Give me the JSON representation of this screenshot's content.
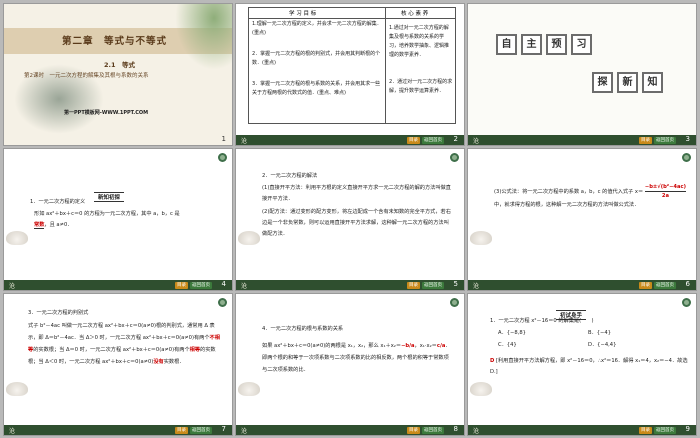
{
  "s1": {
    "chapter": "第二章　等式与不等式",
    "section": "2.1　等式",
    "subtitle": "第2课时　一元二次方程的解集及其根与系数的关系",
    "site": "第一PPT模板网-WWW.1PPT.COM",
    "num": "1"
  },
  "s2": {
    "col1": "学 习 目 标",
    "col2": "核 心 素 养",
    "goals": [
      "1.理解一元二次方程的定义，并会求一元二次方程的解集．(重点)",
      "2．掌握一元二次方程的根的判别式，并会用其判断根的个数．(重点)",
      "3．掌握一元二次方程的根与系数的关系，并会用其求一些关于方程两根的代数式的值．(重点、难点)"
    ],
    "cores": [
      "1.通过对一元二次方程的解集及根与系数的关系的学习，培养数学抽象、逻辑推理的数学素养．",
      "2．通过对一元二次方程的求解，提升数学运算素养．"
    ],
    "num": "2"
  },
  "s3": {
    "a": [
      "自",
      "主",
      "预",
      "习"
    ],
    "b": [
      "探",
      "新",
      "知"
    ],
    "num": "3"
  },
  "s4": {
    "head": "新知初探",
    "t1": "1．一元二次方程的定义",
    "t2": "形如 ax²＋bx＋c＝0 的方程为一元二次方程，其中 a，b，c 是",
    "fill": "常数",
    "t3": "，且 a≠0．",
    "num": "4"
  },
  "s5": {
    "t1": "2．一元二次方程的解法",
    "t2": "(1)直接开平方法：利用平方根的定义直接开平方求一元二次方程的解的方法叫做直接开平方法．",
    "t3": "(2)配方法：通过变形的配方变形，将左边配成一个含有未知数的完全平方式，若右边是一个非负常数，则可以运用直接开平方法求解，这种解一元二次方程的方法叫做配方法．",
    "num": "5"
  },
  "s6": {
    "t1": "(3)公式法：将一元二次方程中的系数 a，b，c 的值代入式子 x＝",
    "f": "−b±√(b²−4ac)",
    "d": "2a",
    "t2": "中，就求得方程的根，这种解一元二次方程的方法叫做公式法．",
    "num": "6"
  },
  "s7": {
    "t1": "3．一元二次方程的判别式",
    "t2": "式子 b²－4ac 叫做一元二次方程 ax²＋bx＋c＝0(a≠0)根的判别式，通常用 Δ 表示，即 Δ＝b²－4ac．当 Δ＞0 时，一元二次方程 ax²",
    "t3": "＋bx＋c＝0(a≠0)有两个",
    "f1": "不相等",
    "t4": "的实数根；当 Δ＝0 时，一元二次方程 ax²＋bx＋c＝0(a≠0)有两个",
    "f2": "相等",
    "t5": "的实数根；当 Δ＜0 时，一元二次方程 ax²＋bx＋c＝0(a≠0)",
    "f3": "没有",
    "t6": "实数根．",
    "num": "7"
  },
  "s8": {
    "t1": "4．一元二次方程的根与系数的关系",
    "t2": "如果 ax²＋bx＋c＝0(a≠0)的两根是 x₁，x₂，那么 x₁＋x₂＝",
    "f1": "−b/a",
    "t3": "，x₁·x₂＝",
    "f2": "c/a",
    "t4": "．即两个根的和等于一次项系数与二次项系数的比的相反数，两个根的积等于常数项与二次项系数的比．",
    "num": "8"
  },
  "s9": {
    "head": "初试身手",
    "q": "1．一元二次方程 x²－16＝0 的解集是(　　)",
    "opts": [
      "A．{−8,8}",
      "B．{−4}",
      "C．{4}",
      "D．{−4,4}"
    ],
    "ans": "D",
    "exp": "[利用直接开平方法解方程，即 x²－16＝0，∴x²＝16．解得 x₁＝4，x₂＝−4．故选 D.]",
    "num": "9"
  },
  "footer": {
    "logo": "沧",
    "b1": "目录",
    "b2": "返回首页"
  }
}
